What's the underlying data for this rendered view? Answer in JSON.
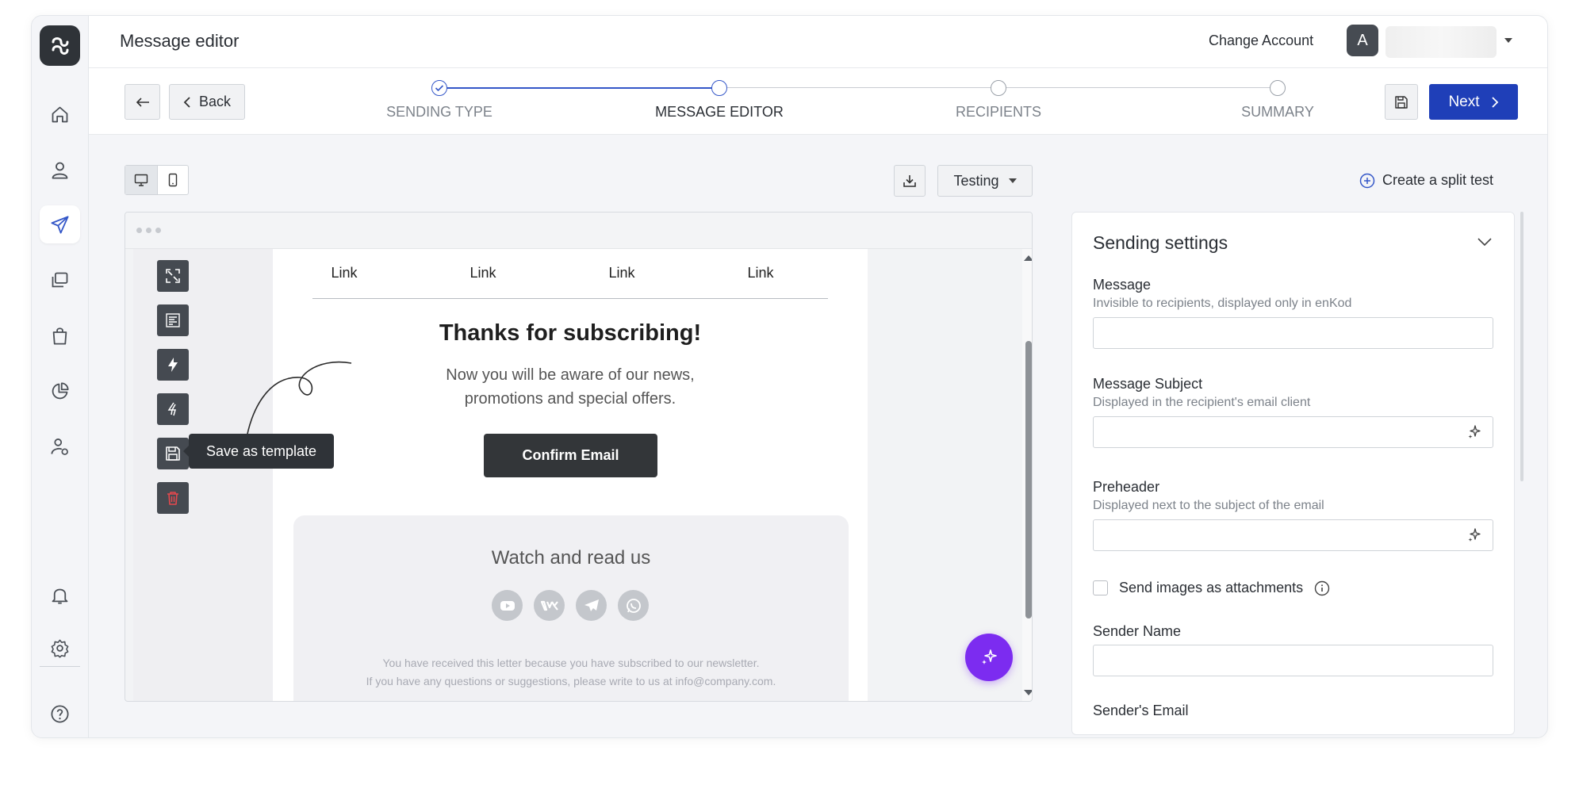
{
  "app": {
    "page_title": "Message editor",
    "change_account": "Change Account",
    "avatar_letter": "A"
  },
  "sidebar": {
    "items": [
      {
        "icon": "home-icon"
      },
      {
        "icon": "user-icon"
      },
      {
        "icon": "send-icon",
        "active": true
      },
      {
        "icon": "copy-icon"
      },
      {
        "icon": "shopping-bag-icon"
      },
      {
        "icon": "pie-chart-icon"
      },
      {
        "icon": "user-settings-icon"
      },
      {
        "icon": "bell-icon"
      },
      {
        "icon": "gear-icon"
      },
      {
        "icon": "help-icon"
      }
    ]
  },
  "stepper": {
    "back_label": "Back",
    "next_label": "Next",
    "steps": [
      {
        "label": "SENDING TYPE",
        "state": "done"
      },
      {
        "label": "MESSAGE EDITOR",
        "state": "current"
      },
      {
        "label": "RECIPIENTS",
        "state": "pending"
      },
      {
        "label": "SUMMARY",
        "state": "pending"
      }
    ]
  },
  "toolbar": {
    "testing_label": "Testing",
    "split_test_label": "Create a split test"
  },
  "editor": {
    "tooltip": "Save as template",
    "tools": [
      "expand-icon",
      "align-left-icon",
      "lightning-icon",
      "lightning-alt-icon",
      "save-icon",
      "trash-icon"
    ],
    "email": {
      "links": [
        "Link",
        "Link",
        "Link",
        "Link"
      ],
      "heading": "Thanks for subscribing!",
      "body": "Now you will be aware of our news, promotions and special offers.",
      "cta": "Confirm Email",
      "footer_heading": "Watch and read us",
      "socials": [
        "youtube-icon",
        "vk-icon",
        "telegram-icon",
        "whatsapp-icon"
      ],
      "legal_1": "You have received this letter because you have subscribed to our newsletter.",
      "legal_2": "If you have any questions or suggestions, please write to us at info@company.com."
    }
  },
  "settings": {
    "title": "Sending settings",
    "message_label": "Message",
    "message_hint": "Invisible to recipients, displayed only in enKod",
    "message_value": "",
    "subject_label": "Message Subject",
    "subject_hint": "Displayed in the recipient's email client",
    "subject_value": "",
    "preheader_label": "Preheader",
    "preheader_hint": "Displayed next to the subject of the email",
    "preheader_value": "",
    "attachments_label": "Send images as attachments",
    "sender_name_label": "Sender Name",
    "sender_name_value": "",
    "sender_email_label": "Sender's Email"
  },
  "colors": {
    "accent": "#1f3fb8",
    "step_active": "#3457c8",
    "ai_button": "#7c2cf0",
    "danger": "#e5484d"
  }
}
